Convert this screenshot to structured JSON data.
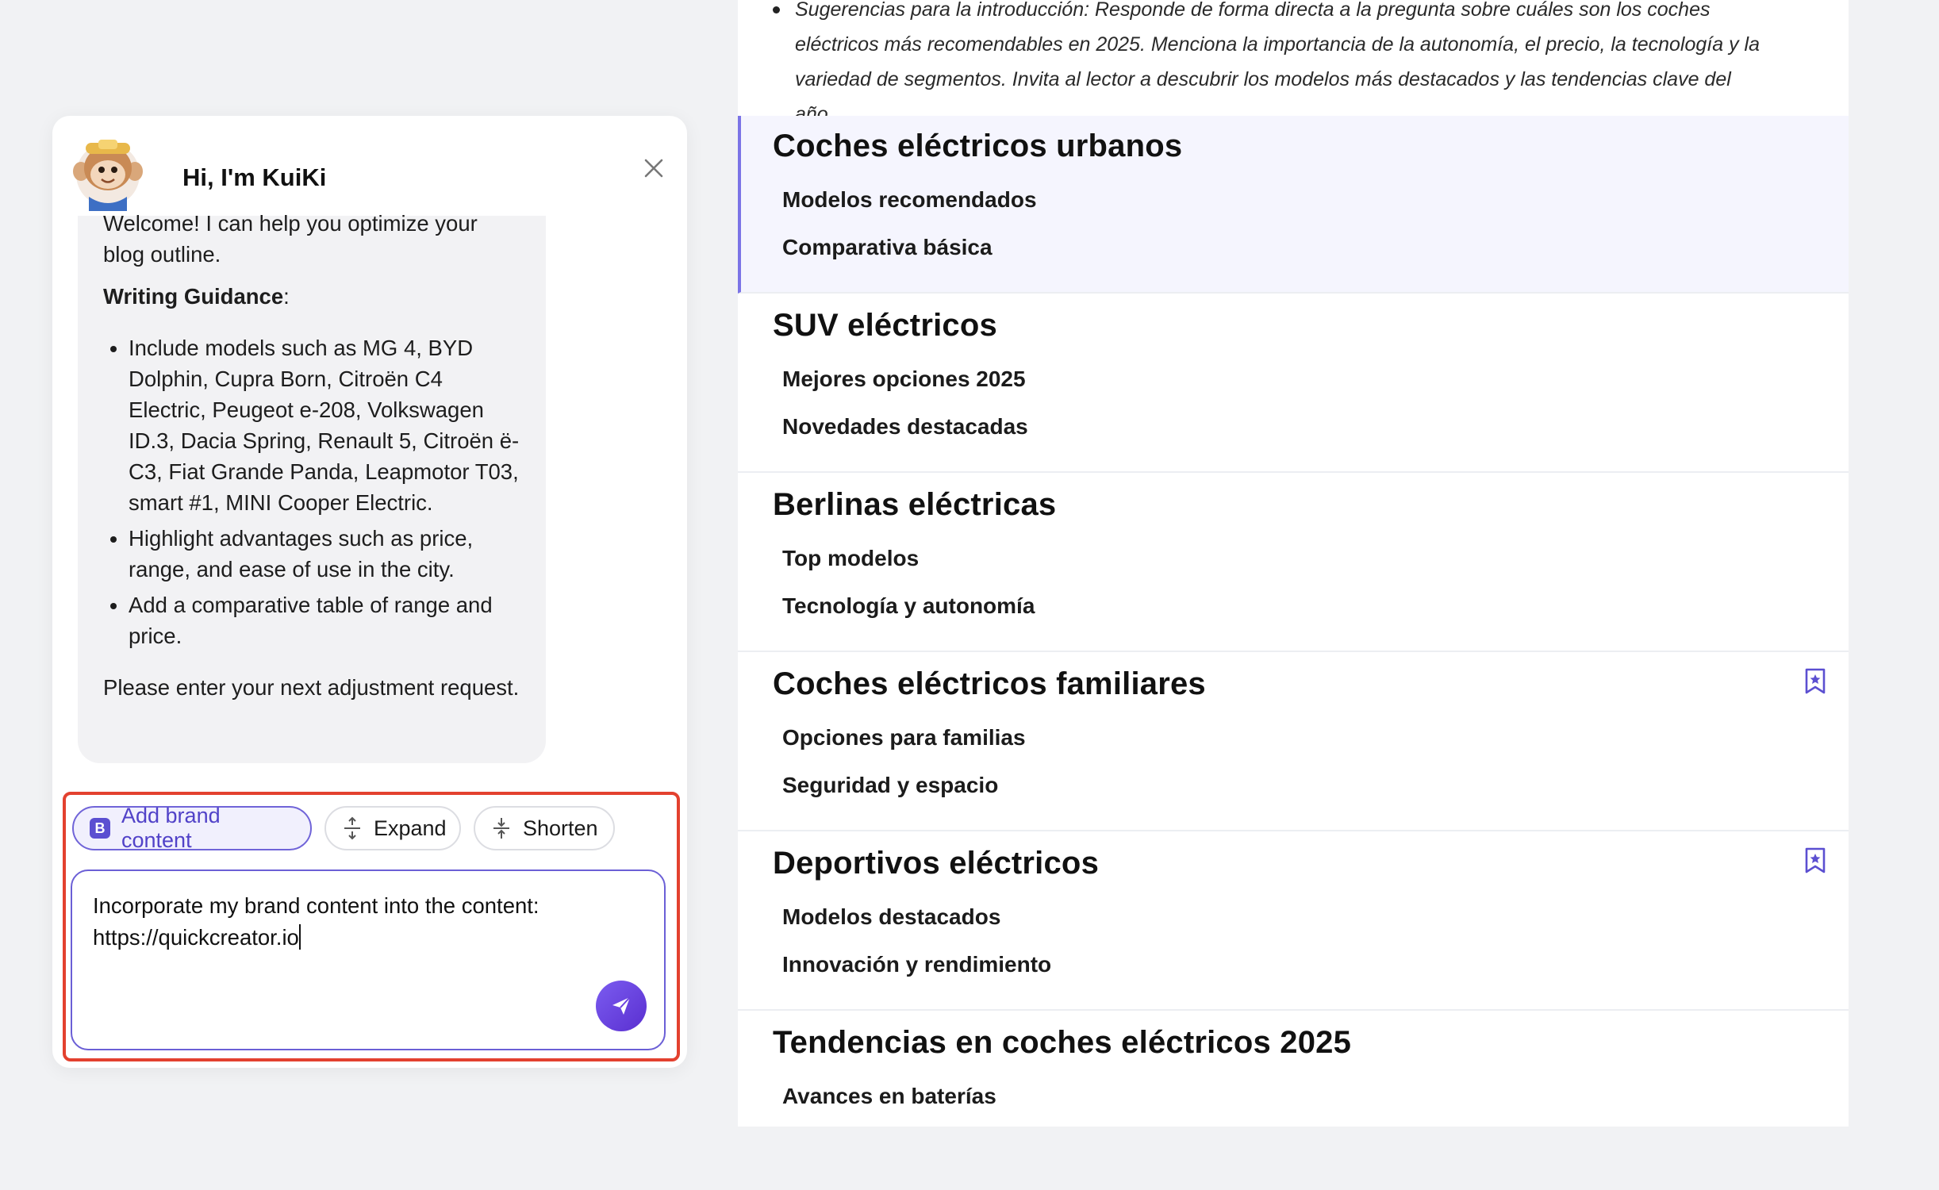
{
  "outline": {
    "intro_text": "Sugerencias para la introducción: Responde de forma directa a la pregunta sobre cuáles son los coches eléctricos más recomendables en 2025. Menciona la importancia de la autonomía, el precio, la tecnología y la variedad de segmentos. Invita al lector a descubrir los modelos más destacados y las tendencias clave del año.",
    "sections": [
      {
        "title": "Coches eléctricos urbanos",
        "subs": [
          "Modelos recomendados",
          "Comparativa básica"
        ],
        "active": true,
        "bookmark": false
      },
      {
        "title": "SUV eléctricos",
        "subs": [
          "Mejores opciones 2025",
          "Novedades destacadas"
        ],
        "active": false,
        "bookmark": false
      },
      {
        "title": "Berlinas eléctricas",
        "subs": [
          "Top modelos",
          "Tecnología y autonomía"
        ],
        "active": false,
        "bookmark": false
      },
      {
        "title": "Coches eléctricos familiares",
        "subs": [
          "Opciones para familias",
          "Seguridad y espacio"
        ],
        "active": false,
        "bookmark": true
      },
      {
        "title": "Deportivos eléctricos",
        "subs": [
          "Modelos destacados",
          "Innovación y rendimiento"
        ],
        "active": false,
        "bookmark": true
      },
      {
        "title": "Tendencias en coches eléctricos 2025",
        "subs": [
          "Avances en baterías",
          ""
        ],
        "active": false,
        "bookmark": false
      }
    ]
  },
  "chat": {
    "title": "Hi, I'm KuiKi",
    "avatar_icon": "monkey-seo-avatar",
    "message": {
      "welcome": "Welcome! I can help you optimize your blog outline.",
      "guidance_label": "Writing Guidance",
      "guidance_colon": ":",
      "bullets": [
        "Include models such as MG 4, BYD Dolphin, Cupra Born, Citroën C4 Electric, Peugeot e-208, Volkswagen ID.3, Dacia Spring, Renault 5, Citroën ë-C3, Fiat Grande Panda, Leapmotor T03, smart #1, MINI Cooper Electric.",
        "Highlight advantages such as price, range, and ease of use in the city.",
        "Add a comparative table of range and price."
      ],
      "next": "Please enter your next adjustment request."
    },
    "chips": {
      "brand": "Add brand content",
      "brand_badge": "B",
      "expand": "Expand",
      "shorten": "Shorten"
    },
    "input": {
      "line1": "Incorporate my brand content into the content:",
      "line2": "https://quickcreator.io"
    }
  },
  "colors": {
    "accent": "#6b5fd6",
    "highlight_border": "#e3412f",
    "active_section_bg": "#f5f5fe"
  }
}
